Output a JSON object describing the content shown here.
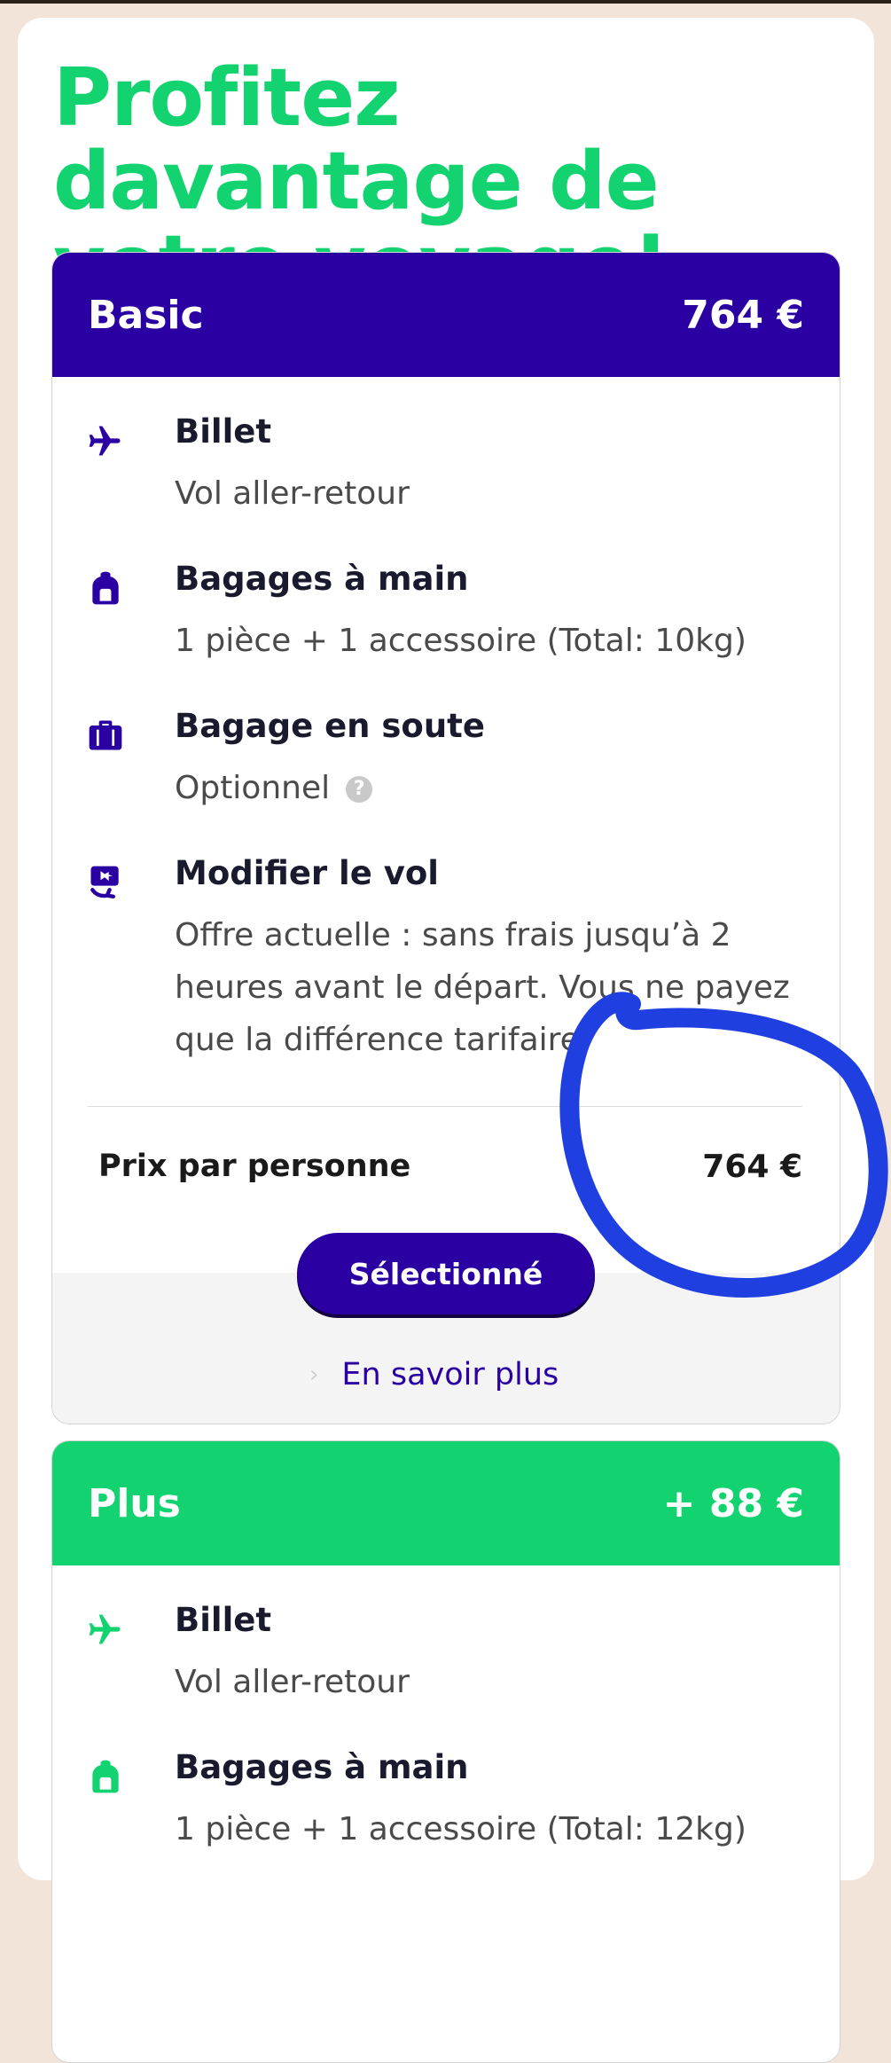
{
  "headline": "Profitez davantage de votre voyage!",
  "colors": {
    "brand_green": "#12d36f",
    "brand_indigo": "#2a00a3",
    "page_bg": "#f2e4d9",
    "annotation_blue": "#1f3fe0"
  },
  "basic": {
    "name": "Basic",
    "price": "764 €",
    "features": [
      {
        "icon": "airplane-icon",
        "title": "Billet",
        "desc": "Vol aller-retour"
      },
      {
        "icon": "backpack-icon",
        "title": "Bagages à main",
        "desc": "1 pièce + 1 accessoire (Total: 10kg)"
      },
      {
        "icon": "suitcase-icon",
        "title": "Bagage en soute",
        "desc": "Optionnel"
      },
      {
        "icon": "change-flight-icon",
        "title": "Modifier le vol",
        "desc": "Offre actuelle : sans frais jusqu’à 2 heures avant le départ. Vous ne payez que la différence tarifaire."
      }
    ],
    "price_label": "Prix par personne",
    "price_value": "764 €",
    "button": "Sélectionné",
    "learn_more": "En savoir plus"
  },
  "plus": {
    "name": "Plus",
    "price": "+ 88 €",
    "features": [
      {
        "icon": "airplane-icon",
        "title": "Billet",
        "desc": "Vol aller-retour"
      },
      {
        "icon": "backpack-icon",
        "title": "Bagages à main",
        "desc": "1 pièce + 1 accessoire (Total: 12kg)"
      }
    ]
  }
}
